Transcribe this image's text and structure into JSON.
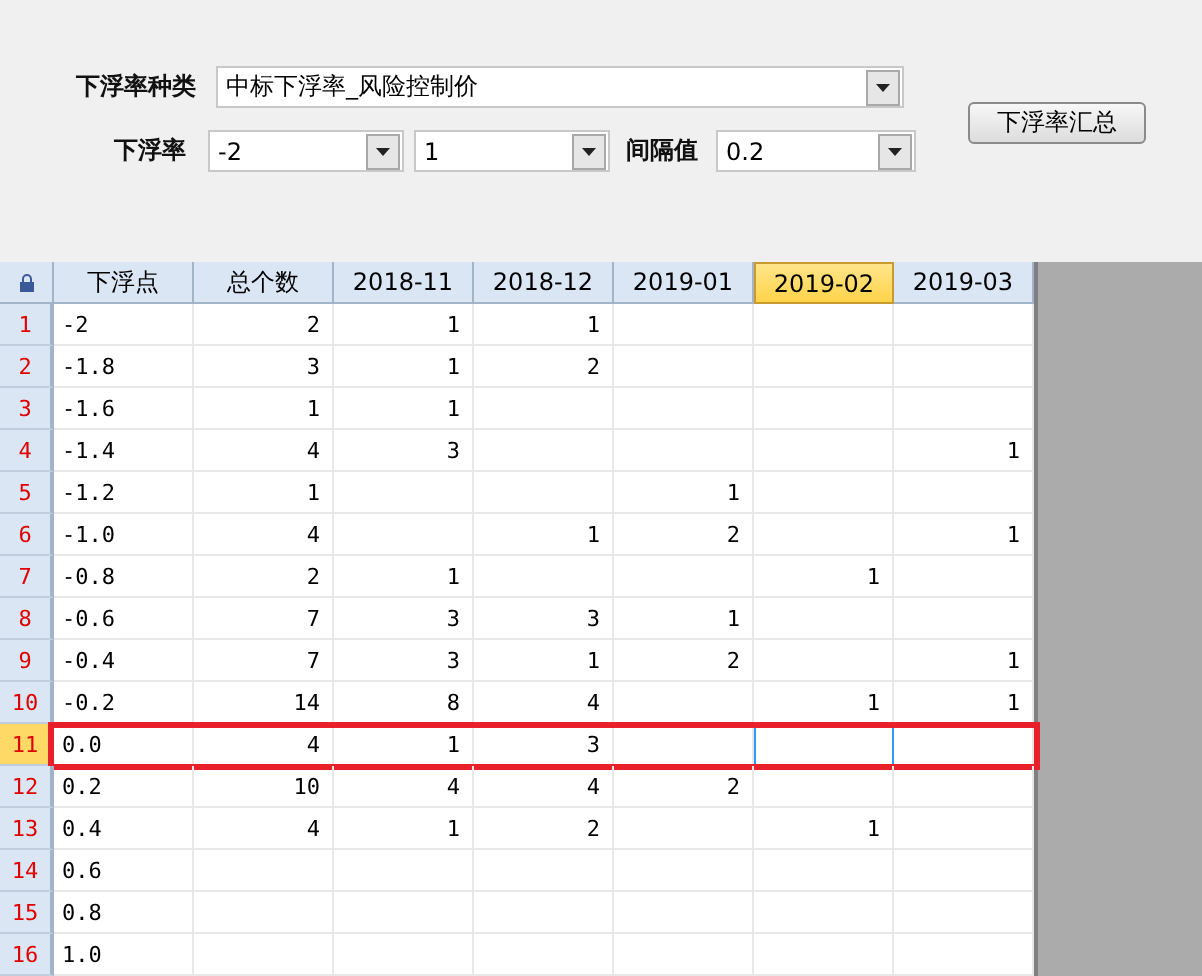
{
  "form": {
    "type_label": "下浮率种类",
    "type_value": "中标下浮率_风险控制价",
    "rate_label": "下浮率",
    "rate_from": "-2",
    "rate_to": "1",
    "interval_label": "间隔值",
    "interval_value": "0.2",
    "button": "下浮率汇总"
  },
  "table": {
    "columns": [
      {
        "label": "下浮点",
        "selected": false
      },
      {
        "label": "总个数",
        "selected": false
      },
      {
        "label": "2018-11",
        "selected": false
      },
      {
        "label": "2018-12",
        "selected": false
      },
      {
        "label": "2019-01",
        "selected": false
      },
      {
        "label": "2019-02",
        "selected": true
      },
      {
        "label": "2019-03",
        "selected": false
      }
    ],
    "rows": [
      {
        "number": "1",
        "selected": false,
        "outlined": false,
        "cells": [
          "-2",
          "2",
          "1",
          "1",
          null,
          null,
          null
        ]
      },
      {
        "number": "2",
        "selected": false,
        "outlined": false,
        "cells": [
          "-1.8",
          "3",
          "1",
          "2",
          null,
          null,
          null
        ]
      },
      {
        "number": "3",
        "selected": false,
        "outlined": false,
        "cells": [
          "-1.6",
          "1",
          "1",
          null,
          null,
          null,
          null
        ]
      },
      {
        "number": "4",
        "selected": false,
        "outlined": false,
        "cells": [
          "-1.4",
          "4",
          "3",
          null,
          null,
          null,
          "1"
        ]
      },
      {
        "number": "5",
        "selected": false,
        "outlined": false,
        "cells": [
          "-1.2",
          "1",
          null,
          null,
          "1",
          null,
          null
        ]
      },
      {
        "number": "6",
        "selected": false,
        "outlined": false,
        "cells": [
          "-1.0",
          "4",
          null,
          "1",
          "2",
          null,
          "1"
        ]
      },
      {
        "number": "7",
        "selected": false,
        "outlined": false,
        "cells": [
          "-0.8",
          "2",
          "1",
          null,
          null,
          "1",
          null
        ]
      },
      {
        "number": "8",
        "selected": false,
        "outlined": false,
        "cells": [
          "-0.6",
          "7",
          "3",
          "3",
          "1",
          null,
          null
        ]
      },
      {
        "number": "9",
        "selected": false,
        "outlined": false,
        "cells": [
          "-0.4",
          "7",
          "3",
          "1",
          "2",
          null,
          "1"
        ]
      },
      {
        "number": "10",
        "selected": false,
        "outlined": false,
        "cells": [
          "-0.2",
          "14",
          "8",
          "4",
          null,
          "1",
          "1"
        ]
      },
      {
        "number": "11",
        "selected": true,
        "outlined": true,
        "cells": [
          "0.0",
          "4",
          "1",
          "3",
          null,
          null,
          null
        ]
      },
      {
        "number": "12",
        "selected": false,
        "outlined": false,
        "cells": [
          "0.2",
          "10",
          "4",
          "4",
          "2",
          null,
          null
        ]
      },
      {
        "number": "13",
        "selected": false,
        "outlined": false,
        "cells": [
          "0.4",
          "4",
          "1",
          "2",
          null,
          "1",
          null
        ]
      },
      {
        "number": "14",
        "selected": false,
        "outlined": false,
        "cells": [
          "0.6",
          null,
          null,
          null,
          null,
          null,
          null
        ]
      },
      {
        "number": "15",
        "selected": false,
        "outlined": false,
        "cells": [
          "0.8",
          null,
          null,
          null,
          null,
          null,
          null
        ]
      },
      {
        "number": "16",
        "selected": false,
        "outlined": false,
        "cells": [
          "1.0",
          null,
          null,
          null,
          null,
          null,
          null
        ]
      }
    ]
  }
}
